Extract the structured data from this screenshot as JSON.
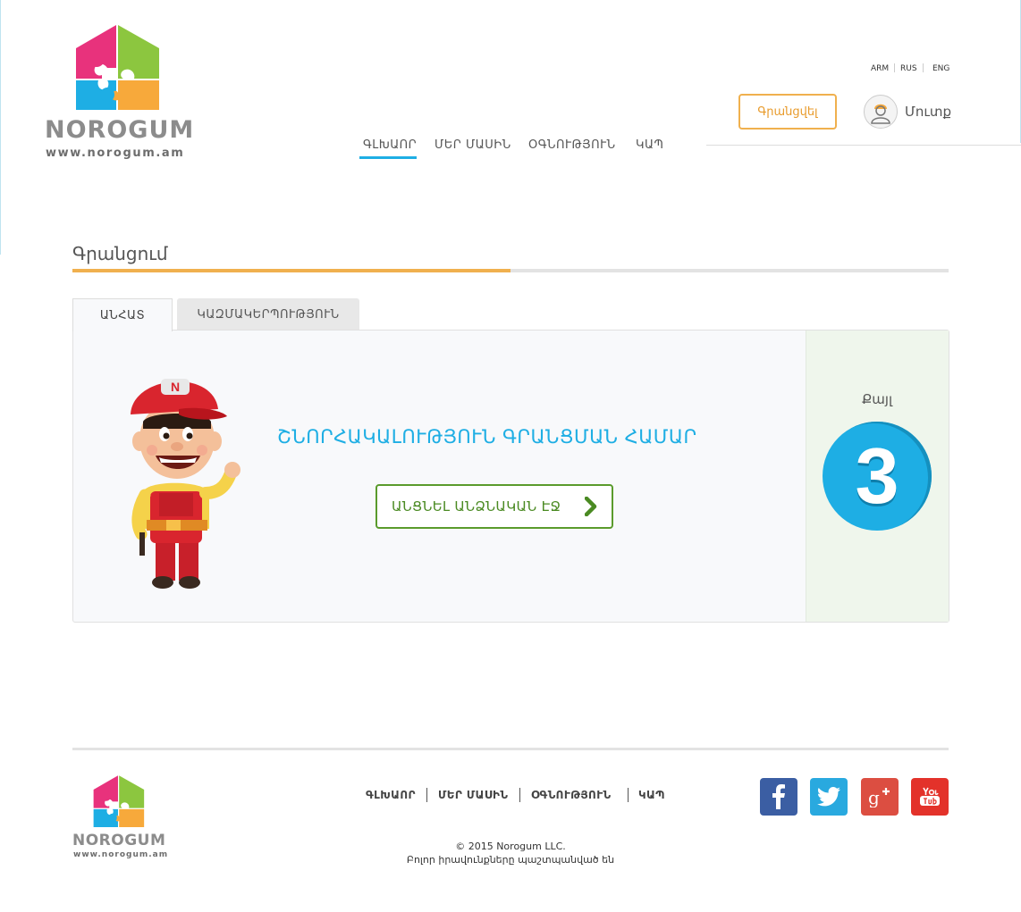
{
  "brand": {
    "name": "NOROGUM",
    "url": "www.norogum.am"
  },
  "languages": [
    "ARM",
    "RUS",
    "ENG"
  ],
  "header": {
    "register_label": "Գրանցվել",
    "login_label": "Մուտք"
  },
  "nav": {
    "items": [
      "ԳԼԽԱՈՐ",
      "ՄԵՐ ՄԱՍԻՆ",
      "ՕԳՆՈՒԹՅՈՒՆ",
      "ԿԱՊ"
    ],
    "active": 0
  },
  "page": {
    "title": "Գրանցում",
    "progress": 0.5
  },
  "tabs": {
    "individual": "ԱՆՀԱՏ",
    "organization": "ԿԱԶՄԱԿԵՐՊՈՒԹՅՈՒՆ"
  },
  "panel": {
    "message": "ՇՆՈՐՀԱԿԱԼՈՒԹՅՈՒՆ ԳՐԱՆՑՄԱՆ ՀԱՄԱՐ",
    "button_label": "ԱՆՑՆԵԼ ԱՆՁՆԱԿԱՆ ԷՋ",
    "step_label": "Քայլ",
    "step_number": "3",
    "mascot_cap_letter": "N"
  },
  "footer": {
    "nav": [
      "ԳԼԽԱՈՐ",
      "ՄԵՐ ՄԱՍԻՆ",
      "ՕԳՆՈՒԹՅՈՒՆ",
      "ԿԱՊ"
    ],
    "copyright": "© 2015 Norogum LLC.",
    "rights": "Բոլոր իրավունքները պաշտպանված են",
    "social": [
      "facebook-icon",
      "twitter-icon",
      "google-plus-icon",
      "youtube-icon"
    ]
  },
  "colors": {
    "accent_blue": "#1eaee4",
    "accent_orange": "#f0b04e",
    "accent_green": "#5a9b2c",
    "side_bg": "#eff6ec"
  }
}
